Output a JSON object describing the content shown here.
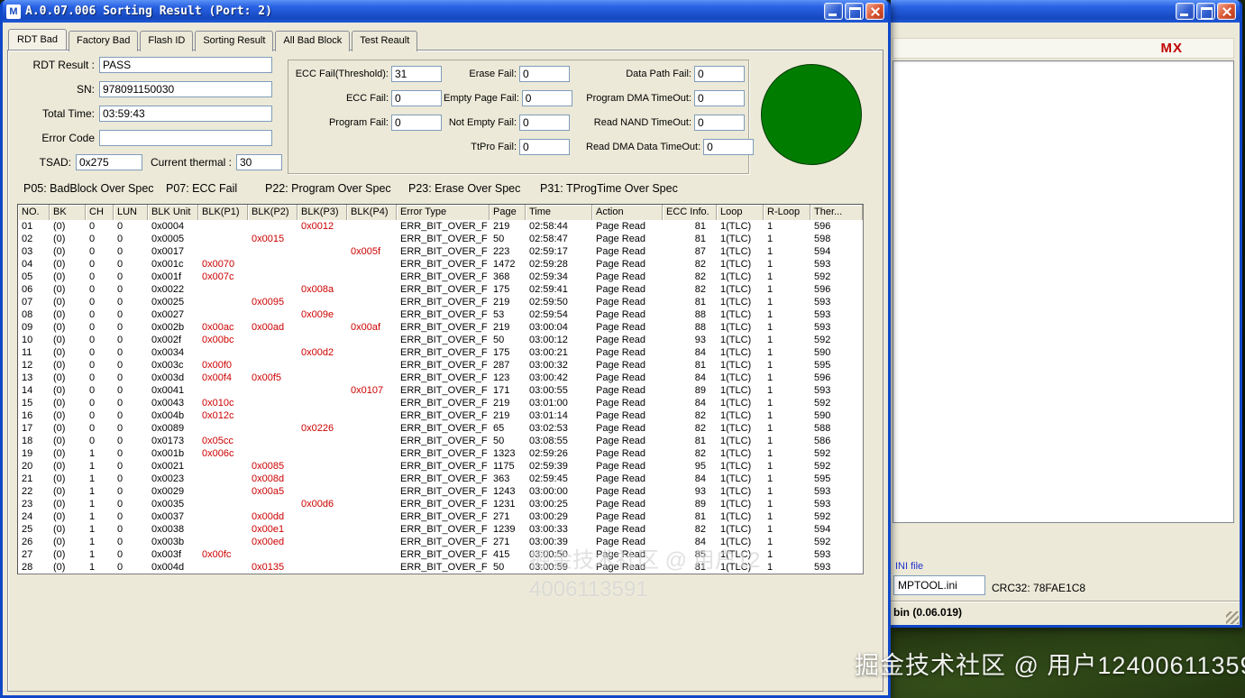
{
  "colors": {
    "error_red": "#cc0000",
    "status_green": "#007d00",
    "title_blue": "#1548c0",
    "ini_label_blue": "#2233cc",
    "mx_red": "#c00000"
  },
  "main_window": {
    "title": "A.0.07.006 Sorting Result (Port: 2)",
    "app_icon_letter": "M",
    "tabs": [
      "RDT Bad",
      "Factory Bad",
      "Flash ID",
      "Sorting Result",
      "All Bad Block",
      "Test Reault"
    ],
    "active_tab_index": 0,
    "form": {
      "rows": [
        {
          "label": "RDT Result :",
          "value": "PASS"
        },
        {
          "label": "SN:",
          "value": "978091150030"
        },
        {
          "label": "Total Time:",
          "value": "03:59:43"
        },
        {
          "label": "Error Code",
          "value": ""
        }
      ],
      "tsad_label": "TSAD:",
      "tsad_value": "0x275",
      "thermal_label": "Current thermal :",
      "thermal_value": "30"
    },
    "counters": {
      "col1": [
        {
          "label": "ECC Fail(Threshold):",
          "value": "31"
        },
        {
          "label": "ECC Fail:",
          "value": "0"
        },
        {
          "label": "Program Fail:",
          "value": "0"
        }
      ],
      "col2": [
        {
          "label": "Erase Fail:",
          "value": "0"
        },
        {
          "label": "Empty Page Fail:",
          "value": "0"
        },
        {
          "label": "Not Empty Fail:",
          "value": "0"
        },
        {
          "label": "TtPro Fail:",
          "value": "0"
        }
      ],
      "col3": [
        {
          "label": "Data Path Fail:",
          "value": "0"
        },
        {
          "label": "Program DMA TimeOut:",
          "value": "0"
        },
        {
          "label": "Read NAND TimeOut:",
          "value": "0"
        },
        {
          "label": "Read DMA Data TimeOut:",
          "value": "0"
        }
      ]
    },
    "status_indicator": "green-pass-circle",
    "legend": [
      "P05: BadBlock Over Spec",
      "P07: ECC Fail",
      "P22: Program Over Spec",
      "P23: Erase Over Spec",
      "P31: TProgTime Over Spec"
    ],
    "table": {
      "columns": [
        "NO.",
        "BK",
        "CH",
        "LUN",
        "BLK Unit",
        "BLK(P1)",
        "BLK(P2)",
        "BLK(P3)",
        "BLK(P4)",
        "Error Type",
        "Page",
        "Time",
        "Action",
        "ECC Info.",
        "Loop",
        "R-Loop",
        "Ther..."
      ],
      "rows": [
        [
          "01",
          "(0)",
          "0",
          "0",
          "0x0004",
          "",
          "",
          "0x0012",
          "",
          "ERR_BIT_OVER_F",
          "219",
          "02:58:44",
          "Page Read",
          "81",
          "1(TLC)",
          "1",
          "596"
        ],
        [
          "02",
          "(0)",
          "0",
          "0",
          "0x0005",
          "",
          "0x0015",
          "",
          "",
          "ERR_BIT_OVER_F",
          "50",
          "02:58:47",
          "Page Read",
          "81",
          "1(TLC)",
          "1",
          "598"
        ],
        [
          "03",
          "(0)",
          "0",
          "0",
          "0x0017",
          "",
          "",
          "",
          "0x005f",
          "ERR_BIT_OVER_F",
          "223",
          "02:59:17",
          "Page Read",
          "87",
          "1(TLC)",
          "1",
          "594"
        ],
        [
          "04",
          "(0)",
          "0",
          "0",
          "0x001c",
          "0x0070",
          "",
          "",
          "",
          "ERR_BIT_OVER_F",
          "1472",
          "02:59:28",
          "Page Read",
          "82",
          "1(TLC)",
          "1",
          "593"
        ],
        [
          "05",
          "(0)",
          "0",
          "0",
          "0x001f",
          "0x007c",
          "",
          "",
          "",
          "ERR_BIT_OVER_F",
          "368",
          "02:59:34",
          "Page Read",
          "82",
          "1(TLC)",
          "1",
          "592"
        ],
        [
          "06",
          "(0)",
          "0",
          "0",
          "0x0022",
          "",
          "",
          "0x008a",
          "",
          "ERR_BIT_OVER_F",
          "175",
          "02:59:41",
          "Page Read",
          "82",
          "1(TLC)",
          "1",
          "596"
        ],
        [
          "07",
          "(0)",
          "0",
          "0",
          "0x0025",
          "",
          "0x0095",
          "",
          "",
          "ERR_BIT_OVER_F",
          "219",
          "02:59:50",
          "Page Read",
          "81",
          "1(TLC)",
          "1",
          "593"
        ],
        [
          "08",
          "(0)",
          "0",
          "0",
          "0x0027",
          "",
          "",
          "0x009e",
          "",
          "ERR_BIT_OVER_F",
          "53",
          "02:59:54",
          "Page Read",
          "88",
          "1(TLC)",
          "1",
          "593"
        ],
        [
          "09",
          "(0)",
          "0",
          "0",
          "0x002b",
          "0x00ac",
          "0x00ad",
          "",
          "0x00af",
          "ERR_BIT_OVER_F",
          "219",
          "03:00:04",
          "Page Read",
          "88",
          "1(TLC)",
          "1",
          "593"
        ],
        [
          "10",
          "(0)",
          "0",
          "0",
          "0x002f",
          "0x00bc",
          "",
          "",
          "",
          "ERR_BIT_OVER_F",
          "50",
          "03:00:12",
          "Page Read",
          "93",
          "1(TLC)",
          "1",
          "592"
        ],
        [
          "11",
          "(0)",
          "0",
          "0",
          "0x0034",
          "",
          "",
          "0x00d2",
          "",
          "ERR_BIT_OVER_F",
          "175",
          "03:00:21",
          "Page Read",
          "84",
          "1(TLC)",
          "1",
          "590"
        ],
        [
          "12",
          "(0)",
          "0",
          "0",
          "0x003c",
          "0x00f0",
          "",
          "",
          "",
          "ERR_BIT_OVER_F",
          "287",
          "03:00:32",
          "Page Read",
          "81",
          "1(TLC)",
          "1",
          "595"
        ],
        [
          "13",
          "(0)",
          "0",
          "0",
          "0x003d",
          "0x00f4",
          "0x00f5",
          "",
          "",
          "ERR_BIT_OVER_F",
          "123",
          "03:00:42",
          "Page Read",
          "84",
          "1(TLC)",
          "1",
          "596"
        ],
        [
          "14",
          "(0)",
          "0",
          "0",
          "0x0041",
          "",
          "",
          "",
          "0x0107",
          "ERR_BIT_OVER_F",
          "171",
          "03:00:55",
          "Page Read",
          "89",
          "1(TLC)",
          "1",
          "593"
        ],
        [
          "15",
          "(0)",
          "0",
          "0",
          "0x0043",
          "0x010c",
          "",
          "",
          "",
          "ERR_BIT_OVER_F",
          "219",
          "03:01:00",
          "Page Read",
          "84",
          "1(TLC)",
          "1",
          "592"
        ],
        [
          "16",
          "(0)",
          "0",
          "0",
          "0x004b",
          "0x012c",
          "",
          "",
          "",
          "ERR_BIT_OVER_F",
          "219",
          "03:01:14",
          "Page Read",
          "82",
          "1(TLC)",
          "1",
          "590"
        ],
        [
          "17",
          "(0)",
          "0",
          "0",
          "0x0089",
          "",
          "",
          "0x0226",
          "",
          "ERR_BIT_OVER_F",
          "65",
          "03:02:53",
          "Page Read",
          "82",
          "1(TLC)",
          "1",
          "588"
        ],
        [
          "18",
          "(0)",
          "0",
          "0",
          "0x0173",
          "0x05cc",
          "",
          "",
          "",
          "ERR_BIT_OVER_F",
          "50",
          "03:08:55",
          "Page Read",
          "81",
          "1(TLC)",
          "1",
          "586"
        ],
        [
          "19",
          "(0)",
          "1",
          "0",
          "0x001b",
          "0x006c",
          "",
          "",
          "",
          "ERR_BIT_OVER_F",
          "1323",
          "02:59:26",
          "Page Read",
          "82",
          "1(TLC)",
          "1",
          "592"
        ],
        [
          "20",
          "(0)",
          "1",
          "0",
          "0x0021",
          "",
          "0x0085",
          "",
          "",
          "ERR_BIT_OVER_F",
          "1175",
          "02:59:39",
          "Page Read",
          "95",
          "1(TLC)",
          "1",
          "592"
        ],
        [
          "21",
          "(0)",
          "1",
          "0",
          "0x0023",
          "",
          "0x008d",
          "",
          "",
          "ERR_BIT_OVER_F",
          "363",
          "02:59:45",
          "Page Read",
          "84",
          "1(TLC)",
          "1",
          "595"
        ],
        [
          "22",
          "(0)",
          "1",
          "0",
          "0x0029",
          "",
          "0x00a5",
          "",
          "",
          "ERR_BIT_OVER_F",
          "1243",
          "03:00:00",
          "Page Read",
          "93",
          "1(TLC)",
          "1",
          "593"
        ],
        [
          "23",
          "(0)",
          "1",
          "0",
          "0x0035",
          "",
          "",
          "0x00d6",
          "",
          "ERR_BIT_OVER_F",
          "1231",
          "03:00:25",
          "Page Read",
          "89",
          "1(TLC)",
          "1",
          "593"
        ],
        [
          "24",
          "(0)",
          "1",
          "0",
          "0x0037",
          "",
          "0x00dd",
          "",
          "",
          "ERR_BIT_OVER_F",
          "271",
          "03:00:29",
          "Page Read",
          "81",
          "1(TLC)",
          "1",
          "592"
        ],
        [
          "25",
          "(0)",
          "1",
          "0",
          "0x0038",
          "",
          "0x00e1",
          "",
          "",
          "ERR_BIT_OVER_F",
          "1239",
          "03:00:33",
          "Page Read",
          "82",
          "1(TLC)",
          "1",
          "594"
        ],
        [
          "26",
          "(0)",
          "1",
          "0",
          "0x003b",
          "",
          "0x00ed",
          "",
          "",
          "ERR_BIT_OVER_F",
          "271",
          "03:00:39",
          "Page Read",
          "84",
          "1(TLC)",
          "1",
          "592"
        ],
        [
          "27",
          "(0)",
          "1",
          "0",
          "0x003f",
          "0x00fc",
          "",
          "",
          "",
          "ERR_BIT_OVER_F",
          "415",
          "03:00:50",
          "Page Read",
          "85",
          "1(TLC)",
          "1",
          "593"
        ],
        [
          "28",
          "(0)",
          "1",
          "0",
          "0x004d",
          "",
          "0x0135",
          "",
          "",
          "ERR_BIT_OVER_F",
          "50",
          "03:00:59",
          "Page Read",
          "81",
          "1(TLC)",
          "1",
          "593"
        ]
      ]
    }
  },
  "right_window": {
    "mx_label": "MX",
    "ini_section": {
      "label": "INI file",
      "filename": "MPTOOL.ini",
      "crc": "CRC32: 78FAE1C8"
    },
    "status_text": "bin (0.06.019)"
  },
  "watermark": "掘金技术社区 @ 用户124006113591"
}
